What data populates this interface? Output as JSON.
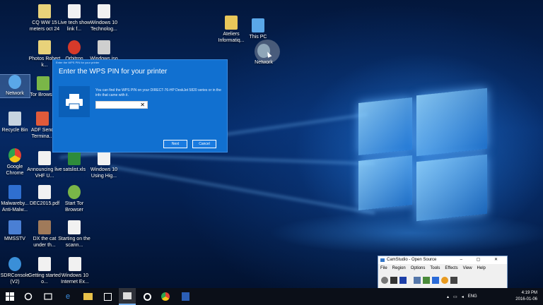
{
  "desktop_icons": [
    {
      "name": "cq-ww-15-icon",
      "label": "CQ WW 15 meters oct 24",
      "color": "#e8d27a"
    },
    {
      "name": "live-tech-icon",
      "label": "Live tech show link f...",
      "color": "#f1f1f1"
    },
    {
      "name": "windows10-tech-icon",
      "label": "Windows 10 Technolog...",
      "color": "#f1f1f1"
    },
    {
      "name": "photos-icon",
      "label": "Photos Robert k...",
      "color": "#e8d27a"
    },
    {
      "name": "orbitron-icon",
      "label": "Orbitron",
      "color": "#d63a2a"
    },
    {
      "name": "windows-iso-icon",
      "label": "Windows.iso",
      "color": "#cfcfcf"
    },
    {
      "name": "network-icon",
      "label": "Network",
      "color": "#5aa7e8"
    },
    {
      "name": "tor-browser-icon",
      "label": "Tor Brows...",
      "color": "#7ab648"
    },
    {
      "name": "recycle-bin-icon",
      "label": "Recycle Bin",
      "color": "#c8d4e0"
    },
    {
      "name": "adf-send-icon",
      "label": "ADF Send Termina...",
      "color": "#e05a3a"
    },
    {
      "name": "google-chrome-icon",
      "label": "Google Chrome",
      "color": "#e8b23a"
    },
    {
      "name": "announcing-icon",
      "label": "Announcing live VHF U...",
      "color": "#f1f1f1"
    },
    {
      "name": "satslist-icon",
      "label": "satslist.xls",
      "color": "#2e8b3a"
    },
    {
      "name": "windows10-using-icon",
      "label": "Windows 10 Using Hig...",
      "color": "#f1f1f1"
    },
    {
      "name": "malwarebytes-icon",
      "label": "Malwareby... Anti-Malw...",
      "color": "#2f6fd0"
    },
    {
      "name": "dec2015-pdf-icon",
      "label": "DEC2015.pdf",
      "color": "#f1f1f1"
    },
    {
      "name": "start-tor-icon",
      "label": "Start Tor Browser",
      "color": "#7ab648"
    },
    {
      "name": "mmsstv-icon",
      "label": "MMSSTV",
      "color": "#4a7fd4"
    },
    {
      "name": "dx-cat-icon",
      "label": "DX the cat under th...",
      "color": "#a07a5a"
    },
    {
      "name": "starting-scann-icon",
      "label": "Starting on the scann...",
      "color": "#f1f1f1"
    },
    {
      "name": "sdrconsole-icon",
      "label": "SDRConsole (V2)",
      "color": "#3a8fd8"
    },
    {
      "name": "getting-started-icon",
      "label": "Getting started o...",
      "color": "#f1f1f1"
    },
    {
      "name": "windows10-internet-icon",
      "label": "Windows 10 Internet Ex...",
      "color": "#f1f1f1"
    },
    {
      "name": "ateliers-icon",
      "label": "Ateliers Informatiq...",
      "color": "#e8c75a"
    },
    {
      "name": "this-pc-icon",
      "label": "This PC",
      "color": "#5aa7e8"
    },
    {
      "name": "network-right-icon",
      "label": "Network",
      "color": "#8fa6b8"
    }
  ],
  "dialog": {
    "window_title": "Enter the WPS PIN for your printer",
    "heading": "Enter the WPS PIN for your printer",
    "description": "You can find the WPS PIN on your DIRECT-76-HP DeskJet 5820 series or in the info that came with it.",
    "pin_value": "",
    "clear_glyph": "✕",
    "next_label": "Next",
    "cancel_label": "Cancel"
  },
  "camstudio": {
    "title": "CamStudio - Open Source",
    "controls": "– ▢ ✕",
    "menu": [
      "File",
      "Region",
      "Options",
      "Tools",
      "Effects",
      "View",
      "Help"
    ]
  },
  "taskbar": {
    "language": "ENG",
    "time": "4:19 PM",
    "date": "2016-01-06"
  },
  "colors": {
    "dialog_bg": "#1170d0",
    "accent": "#3a8be0",
    "taskbar": "#0b0f18"
  }
}
